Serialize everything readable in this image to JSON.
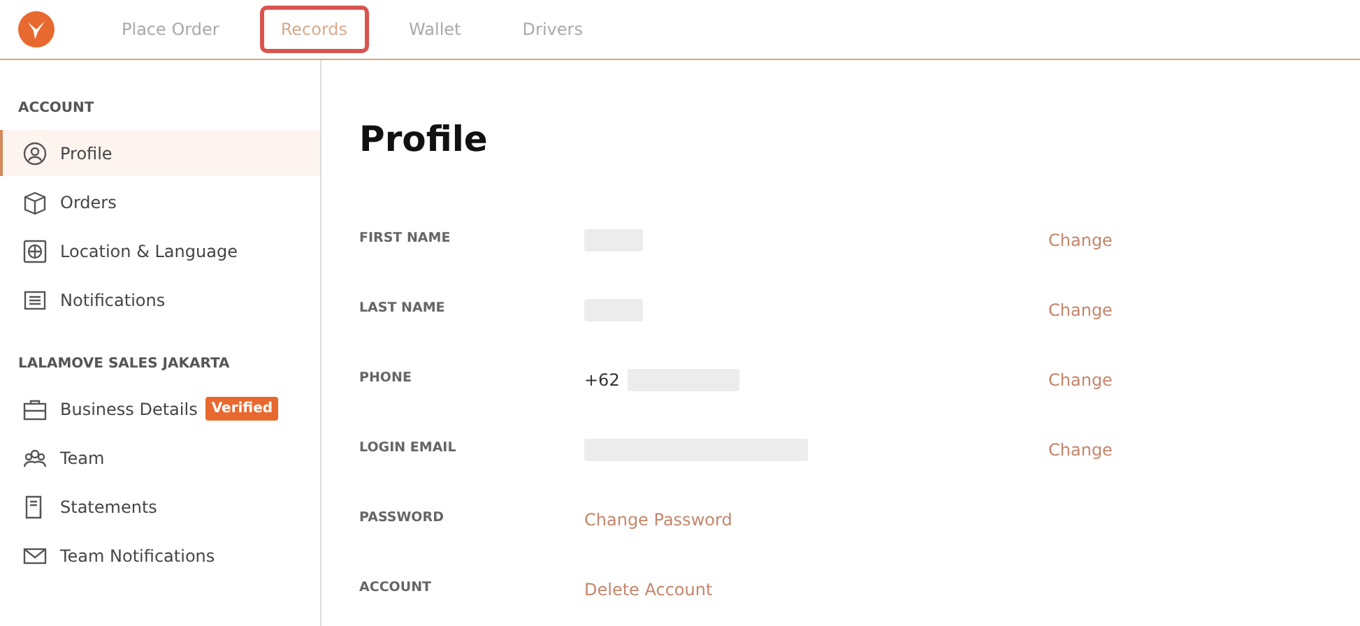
{
  "nav": {
    "tabs": [
      {
        "label": "Place Order",
        "selected": false,
        "highlighted": false
      },
      {
        "label": "Records",
        "selected": true,
        "highlighted": true
      },
      {
        "label": "Wallet",
        "selected": false,
        "highlighted": false
      },
      {
        "label": "Drivers",
        "selected": false,
        "highlighted": false
      }
    ]
  },
  "sidebar": {
    "sections": [
      {
        "title": "ACCOUNT",
        "items": [
          {
            "label": "Profile",
            "selected": true
          },
          {
            "label": "Orders",
            "selected": false
          },
          {
            "label": "Location & Language",
            "selected": false
          },
          {
            "label": "Notifications",
            "selected": false
          }
        ]
      },
      {
        "title": "LALAMOVE SALES JAKARTA",
        "items": [
          {
            "label": "Business Details",
            "selected": false,
            "badge": "Verified"
          },
          {
            "label": "Team",
            "selected": false
          },
          {
            "label": "Statements",
            "selected": false
          },
          {
            "label": "Team Notifications",
            "selected": false
          }
        ]
      }
    ]
  },
  "profile": {
    "title": "Profile",
    "fields": [
      {
        "label": "FIRST NAME",
        "redacted": true,
        "action": "Change"
      },
      {
        "label": "LAST NAME",
        "redacted": true,
        "action": "Change"
      },
      {
        "label": "PHONE",
        "value": "+62",
        "redacted": true,
        "action": "Change"
      },
      {
        "label": "LOGIN EMAIL",
        "redacted": true,
        "action": "Change"
      },
      {
        "label": "PASSWORD",
        "link": "Change Password"
      },
      {
        "label": "ACCOUNT",
        "link": "Delete Account"
      }
    ]
  }
}
